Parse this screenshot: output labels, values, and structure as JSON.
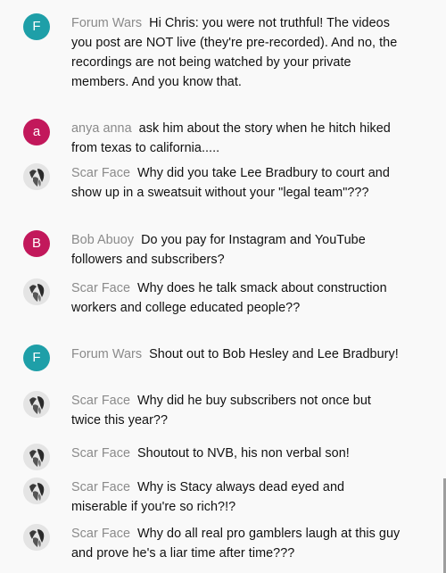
{
  "colors": {
    "teal": "#1e9fa8",
    "magenta": "#c2185b",
    "author_gray": "#8a8a8a",
    "text": "#111111",
    "background": "#f9f9f9"
  },
  "messages": [
    {
      "author": "Forum Wars",
      "avatar_type": "letter",
      "avatar_letter": "F",
      "avatar_color": "#1e9fa8",
      "text": "Hi Chris: you were not truthful! The videos you post are NOT live (they're pre-recorded). And no, the recordings are not being watched by your private members. And you know that."
    },
    {
      "author": "anya anna",
      "avatar_type": "letter",
      "avatar_letter": "a",
      "avatar_color": "#c2185b",
      "text": "ask him about the story when he hitch hiked from texas to california....."
    },
    {
      "author": "Scar Face",
      "avatar_type": "photo",
      "avatar_icon": "profile-photo-icon",
      "text": "Why did you take Lee Bradbury to court and show up in a sweatsuit without your \"legal team\"???"
    },
    {
      "author": "Bob Abuoy",
      "avatar_type": "letter",
      "avatar_letter": "B",
      "avatar_color": "#c2185b",
      "text": "Do you pay for Instagram and YouTube followers and subscribers?"
    },
    {
      "author": "Scar Face",
      "avatar_type": "photo",
      "avatar_icon": "profile-photo-icon",
      "text": "Why does he talk smack about construction workers and college educated people??"
    },
    {
      "author": "Forum Wars",
      "avatar_type": "letter",
      "avatar_letter": "F",
      "avatar_color": "#1e9fa8",
      "text": "Shout out to Bob Hesley and Lee Bradbury!"
    },
    {
      "author": "Scar Face",
      "avatar_type": "photo",
      "avatar_icon": "profile-photo-icon",
      "text": "Why did he buy subscribers not once but twice this year??"
    },
    {
      "author": "Scar Face",
      "avatar_type": "photo",
      "avatar_icon": "profile-photo-icon",
      "text": "Shoutout to NVB, his non verbal son!"
    },
    {
      "author": "Scar Face",
      "avatar_type": "photo",
      "avatar_icon": "profile-photo-icon",
      "text": "Why is Stacy always dead eyed and miserable if you're so rich?!?"
    },
    {
      "author": "Scar Face",
      "avatar_type": "photo",
      "avatar_icon": "profile-photo-icon",
      "text": "Why do all real pro gamblers laugh at this guy and prove he's a liar time after time???"
    }
  ]
}
